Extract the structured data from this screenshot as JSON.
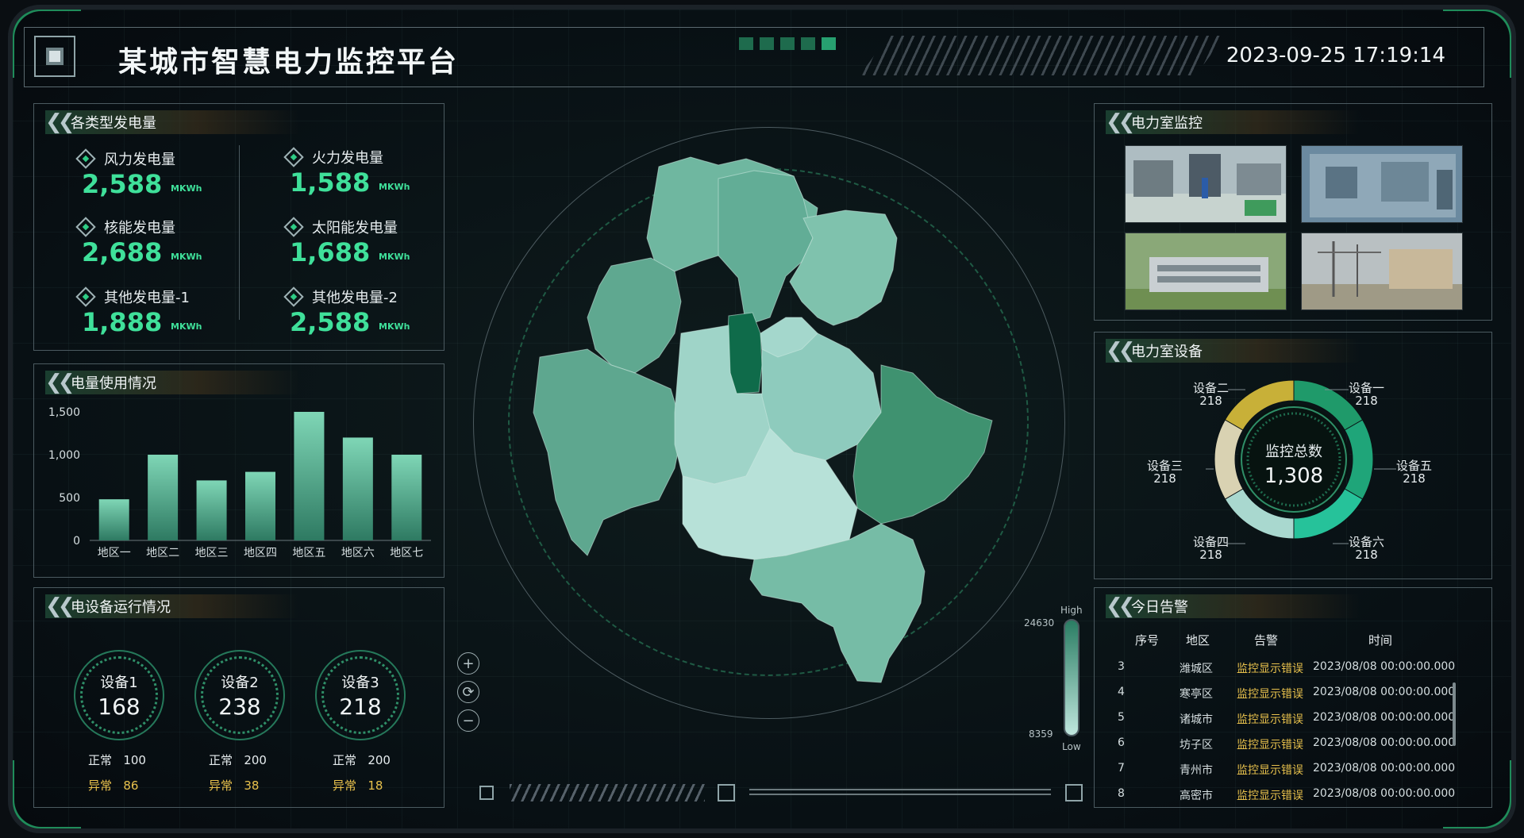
{
  "header": {
    "title": "某城市智慧电力监控平台",
    "datetime": "2023-09-25 17:19:14"
  },
  "generation": {
    "title": "各类型发电量",
    "items": [
      {
        "label": "风力发电量",
        "value": "2,588",
        "unit": "MKWh"
      },
      {
        "label": "火力发电量",
        "value": "1,588",
        "unit": "MKWh"
      },
      {
        "label": "核能发电量",
        "value": "2,688",
        "unit": "MKWh"
      },
      {
        "label": "太阳能发电量",
        "value": "1,688",
        "unit": "MKWh"
      },
      {
        "label": "其他发电量-1",
        "value": "1,888",
        "unit": "MKWh"
      },
      {
        "label": "其他发电量-2",
        "value": "2,588",
        "unit": "MKWh"
      }
    ]
  },
  "usage": {
    "title": "电量使用情况",
    "chart_data": {
      "type": "bar",
      "categories": [
        "地区一",
        "地区二",
        "地区三",
        "地区四",
        "地区五",
        "地区六",
        "地区七"
      ],
      "values": [
        480,
        1000,
        700,
        800,
        1500,
        1200,
        1000
      ],
      "ylim": [
        0,
        1500
      ],
      "yticks": [
        "0",
        "500",
        "1,000",
        "1,500"
      ]
    }
  },
  "devices": {
    "title": "电设备运行情况",
    "ok_label": "正常",
    "err_label": "异常",
    "items": [
      {
        "name": "设备1",
        "total": "168",
        "ok": "100",
        "err": "86"
      },
      {
        "name": "设备2",
        "total": "238",
        "ok": "200",
        "err": "38"
      },
      {
        "name": "设备3",
        "total": "218",
        "ok": "200",
        "err": "18"
      }
    ]
  },
  "map": {
    "legend_high_label": "High",
    "legend_low_label": "Low",
    "legend_max": "24630",
    "legend_min": "8359",
    "zoom_in": "+",
    "zoom_reset": "⟳",
    "zoom_out": "−"
  },
  "room_monitor": {
    "title": "电力室监控"
  },
  "room_devices": {
    "title": "电力室设备",
    "center_label": "监控总数",
    "center_value": "1,308",
    "chart_data": {
      "type": "pie",
      "categories": [
        "设备一",
        "设备五",
        "设备六",
        "设备四",
        "设备三",
        "设备二"
      ],
      "values": [
        218,
        218,
        218,
        218,
        218,
        218
      ],
      "value_labels": [
        "218",
        "218",
        "218",
        "218",
        "218",
        "218"
      ],
      "colors": [
        "#1f9a6a",
        "#1fa579",
        "#26c29a",
        "#a9d8cf",
        "#d9d2b2",
        "#c8b038"
      ]
    }
  },
  "alarms": {
    "title": "今日告警",
    "headers": [
      "序号",
      "地区",
      "告警",
      "时间"
    ],
    "rows": [
      {
        "idx": "3",
        "area": "潍城区",
        "alarm": "监控显示错误",
        "time": "2023/08/08 00:00:00.000"
      },
      {
        "idx": "4",
        "area": "寒亭区",
        "alarm": "监控显示错误",
        "time": "2023/08/08 00:00:00.000"
      },
      {
        "idx": "5",
        "area": "诸城市",
        "alarm": "监控显示错误",
        "time": "2023/08/08 00:00:00.000"
      },
      {
        "idx": "6",
        "area": "坊子区",
        "alarm": "监控显示错误",
        "time": "2023/08/08 00:00:00.000"
      },
      {
        "idx": "7",
        "area": "青州市",
        "alarm": "监控显示错误",
        "time": "2023/08/08 00:00:00.000"
      },
      {
        "idx": "8",
        "area": "高密市",
        "alarm": "监控显示错误",
        "time": "2023/08/08 00:00:00.000"
      }
    ]
  }
}
